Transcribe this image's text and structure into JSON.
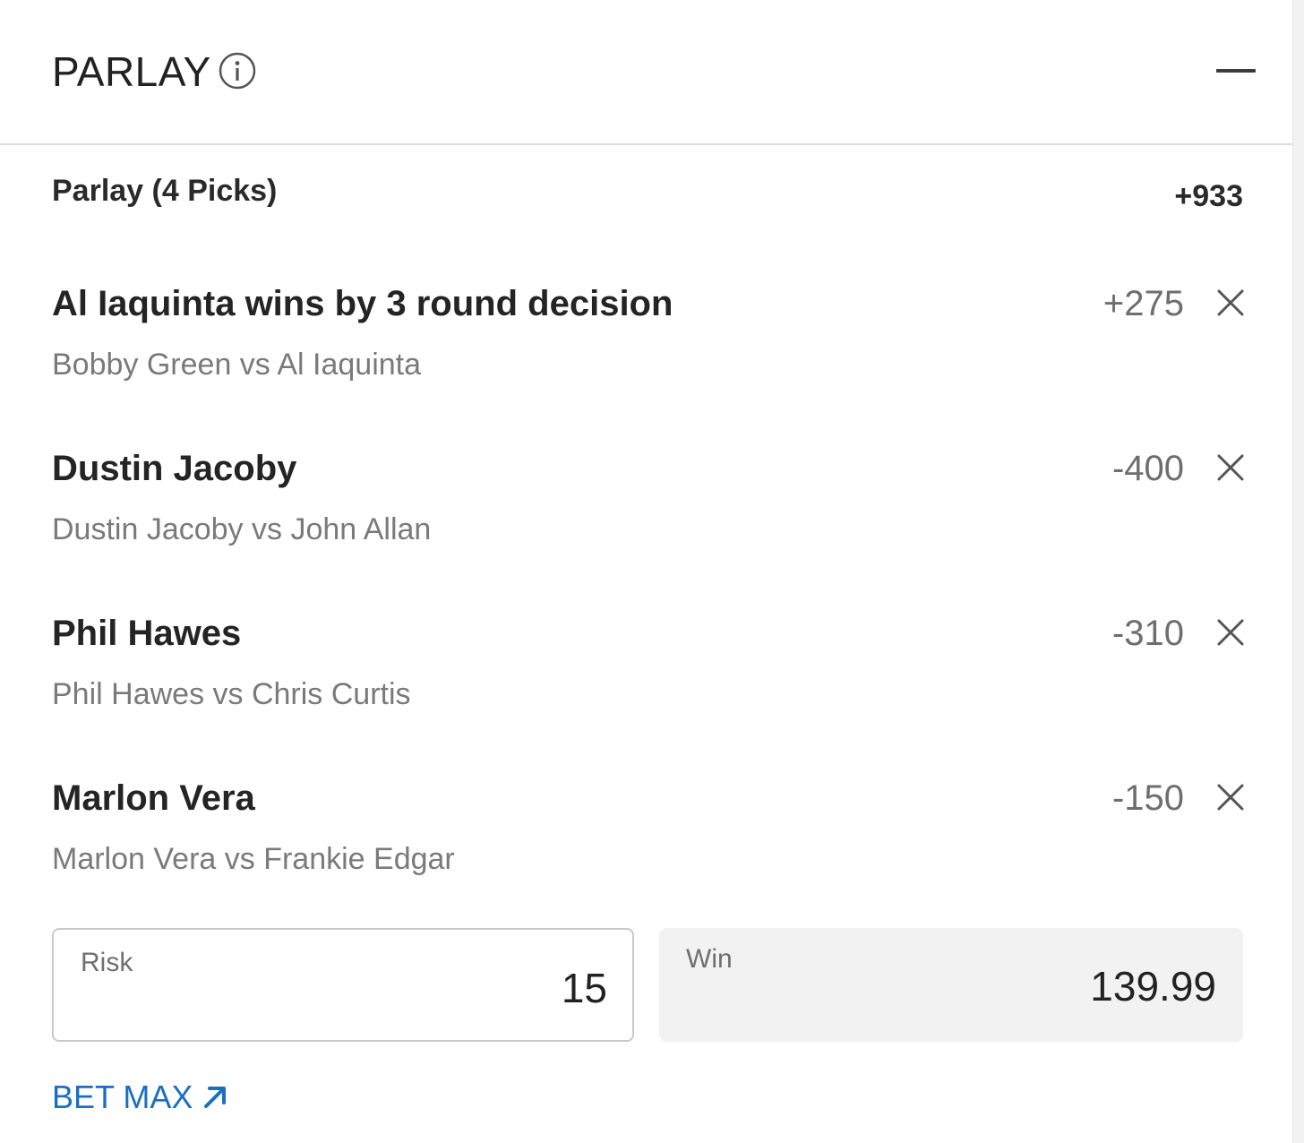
{
  "header": {
    "title": "PARLAY"
  },
  "parlay": {
    "label": "Parlay (4 Picks)",
    "odds": "+933"
  },
  "picks": [
    {
      "selection": "Al Iaquinta wins by 3 round decision",
      "matchup": "Bobby Green vs Al Iaquinta",
      "odds": "+275"
    },
    {
      "selection": "Dustin Jacoby",
      "matchup": "Dustin Jacoby vs John Allan",
      "odds": "-400"
    },
    {
      "selection": "Phil Hawes",
      "matchup": "Phil Hawes vs Chris Curtis",
      "odds": "-310"
    },
    {
      "selection": "Marlon Vera",
      "matchup": "Marlon Vera vs Frankie Edgar",
      "odds": "-150"
    }
  ],
  "stake": {
    "risk_label": "Risk",
    "risk_value": "15",
    "win_label": "Win",
    "win_value": "139.99"
  },
  "bet_max": {
    "label": "BET MAX"
  },
  "colors": {
    "accent": "#1a6fc2",
    "muted_text": "#7a7a7a",
    "divider": "#dcdcdc",
    "win_bg": "#f2f2f2"
  }
}
